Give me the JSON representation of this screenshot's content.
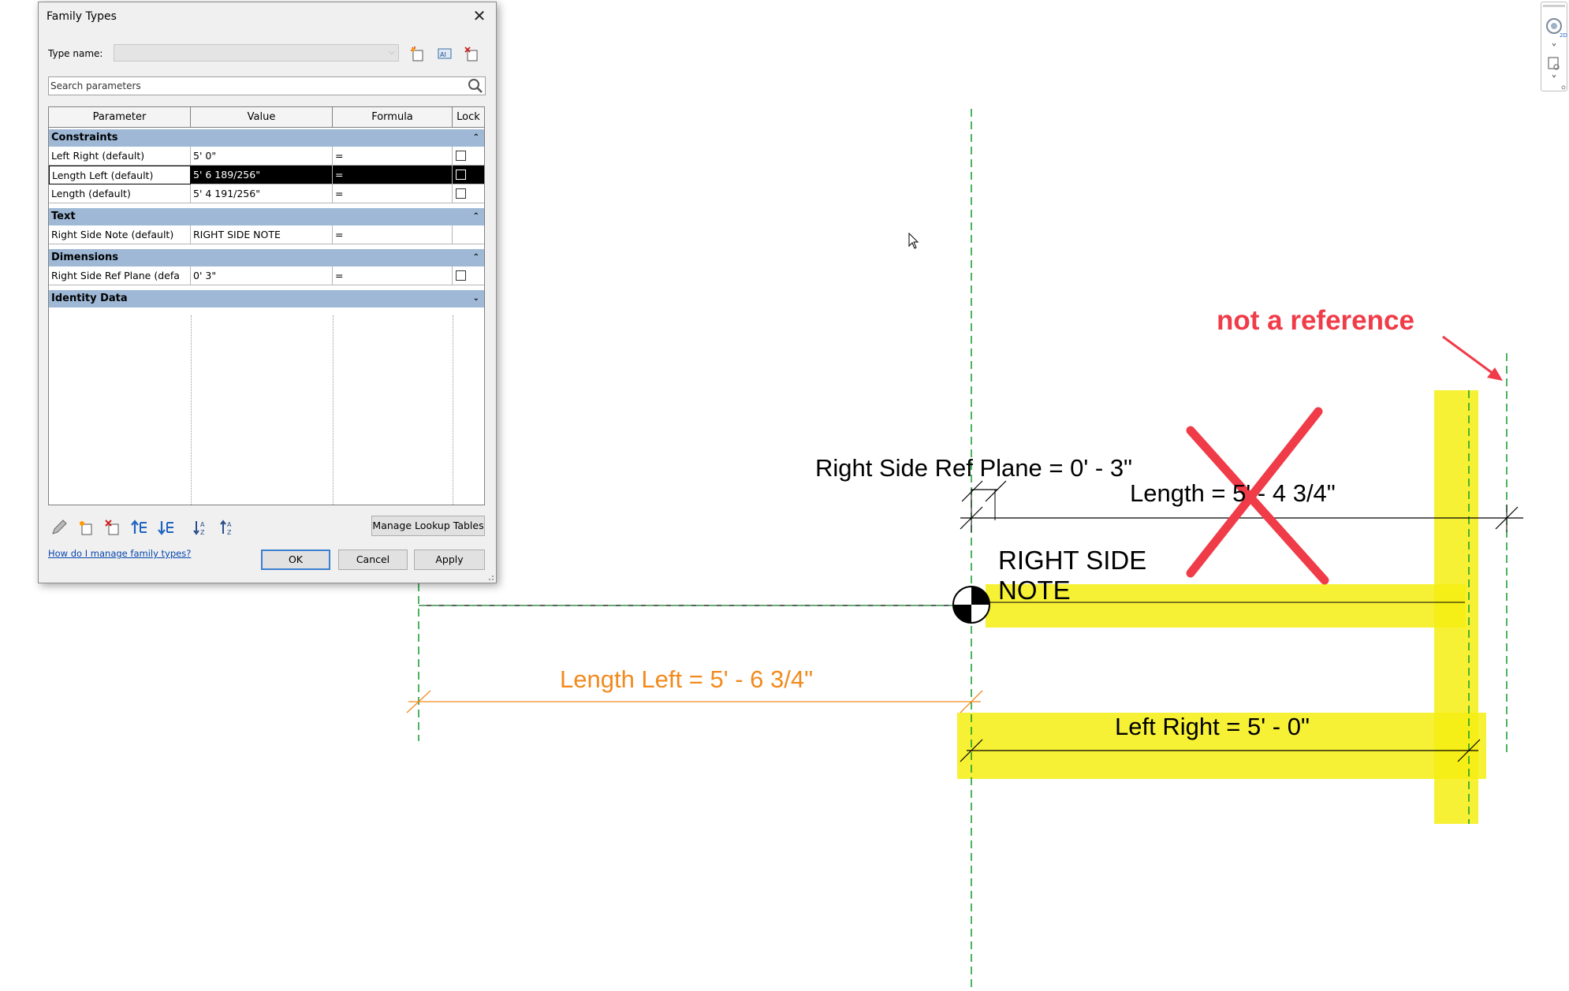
{
  "dialog": {
    "title": "Family Types",
    "type_name_label": "Type name:",
    "type_name_value": "",
    "search_placeholder": "Search parameters",
    "columns": [
      "Parameter",
      "Value",
      "Formula",
      "Lock"
    ],
    "groups": {
      "constraints": {
        "label": "Constraints",
        "rows": [
          {
            "param": "Left Right (default)",
            "value": "5'  0\"",
            "formula": "=",
            "locked": false
          },
          {
            "param": "Length Left (default)",
            "value": "5'  6 189/256\"",
            "formula": "=",
            "locked": false,
            "selected": true
          },
          {
            "param": "Length (default)",
            "value": "5'  4 191/256\"",
            "formula": "=",
            "locked": false
          }
        ]
      },
      "text": {
        "label": "Text",
        "rows": [
          {
            "param": "Right Side Note (default)",
            "value": "RIGHT SIDE NOTE",
            "formula": "="
          }
        ]
      },
      "dimensions": {
        "label": "Dimensions",
        "rows": [
          {
            "param": "Right Side Ref Plane (defa",
            "value": "0'  3\"",
            "formula": "=",
            "locked": false
          }
        ]
      },
      "identity": {
        "label": "Identity Data"
      }
    },
    "manage_lookup_label": "Manage Lookup Tables",
    "help_link": "How do I manage family types?",
    "ok_label": "OK",
    "cancel_label": "Cancel",
    "apply_label": "Apply"
  },
  "drawing": {
    "ref_plane_dim_label": "Right Side Ref Plane = 0' - 3\"",
    "length_dim_label": "Length = 5' - 4 3/4\"",
    "note_text_line1": "RIGHT SIDE",
    "note_text_line2": "NOTE",
    "length_left_dim_label": "Length Left = 5' - 6 3/4\"",
    "left_right_dim_label": "Left Right = 5' - 0\"",
    "annotation_text": "not a reference"
  },
  "colors": {
    "ref_plane": "#119a2a",
    "highlight": "#f6ef12",
    "annotation_red": "#f03b48",
    "selected_dim": "#f28a1e",
    "group_header": "#9eb8d6"
  }
}
